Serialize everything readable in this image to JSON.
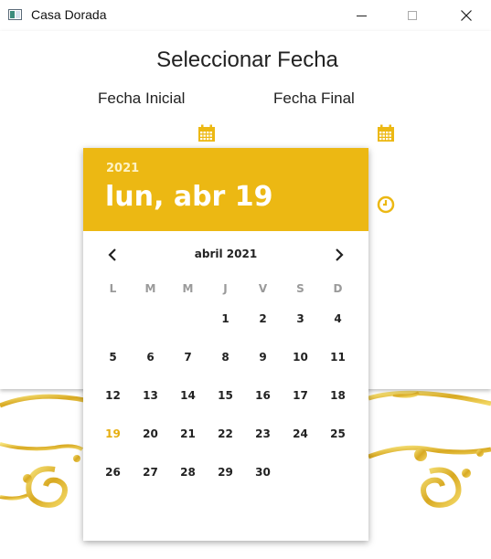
{
  "window": {
    "title": "Casa Dorada",
    "title_icon": "app-window-icon"
  },
  "page": {
    "heading": "Seleccionar Fecha",
    "start_label": "Fecha Inicial",
    "end_label": "Fecha Final"
  },
  "icons": {
    "calendar": "calendar-icon",
    "clock": "clock-icon"
  },
  "colors": {
    "accent": "#ECB813",
    "selected_day": "#E6AE10",
    "weekday_header": "#9A9A9A"
  },
  "picker": {
    "year": "2021",
    "selected_date": "lun, abr 19",
    "month_label": "abril 2021",
    "weekdays": [
      "L",
      "M",
      "M",
      "J",
      "V",
      "S",
      "D"
    ],
    "days": [
      "",
      "",
      "",
      "1",
      "2",
      "3",
      "4",
      "5",
      "6",
      "7",
      "8",
      "9",
      "10",
      "11",
      "12",
      "13",
      "14",
      "15",
      "16",
      "17",
      "18",
      "19",
      "20",
      "21",
      "22",
      "23",
      "24",
      "25",
      "26",
      "27",
      "28",
      "29",
      "30",
      "",
      ""
    ],
    "selected_day": "19"
  }
}
